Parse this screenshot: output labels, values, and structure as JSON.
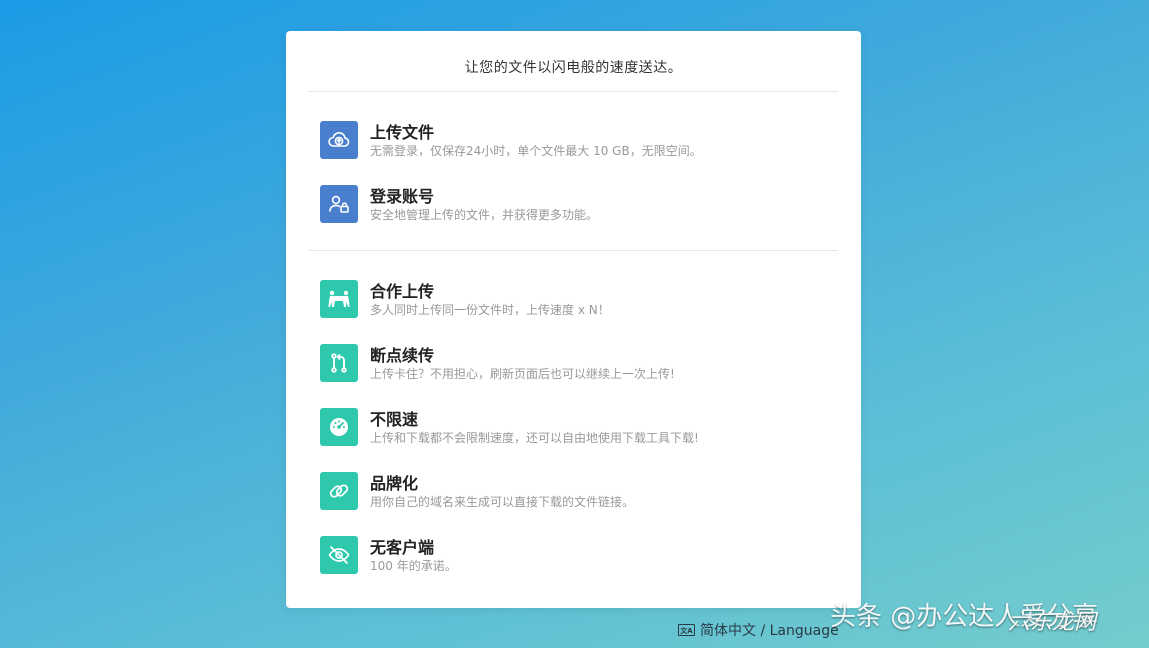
{
  "tagline": "让您的文件以闪电般的速度送达。",
  "features_primary": [
    {
      "icon": "cloud-upload-icon",
      "title": "上传文件",
      "desc": "无需登录，仅保存24小时，单个文件最大 10 GB，无限空间。"
    },
    {
      "icon": "user-lock-icon",
      "title": "登录账号",
      "desc": "安全地管理上传的文件，并获得更多功能。"
    }
  ],
  "features_secondary": [
    {
      "icon": "collaboration-icon",
      "title": "合作上传",
      "desc": "多人同时上传同一份文件时，上传速度 x N！"
    },
    {
      "icon": "resume-branch-icon",
      "title": "断点续传",
      "desc": "上传卡住？不用担心，刷新页面后也可以继续上一次上传!"
    },
    {
      "icon": "speedometer-icon",
      "title": "不限速",
      "desc": "上传和下载都不会限制速度，还可以自由地使用下载工具下载!"
    },
    {
      "icon": "link-icon",
      "title": "品牌化",
      "desc": "用你自己的域名来生成可以直接下载的文件链接。"
    },
    {
      "icon": "eye-off-icon",
      "title": "无客户端",
      "desc": "100 年的承诺。"
    }
  ],
  "language": {
    "icon": "language-icon",
    "label": "简体中文 / Language"
  },
  "watermark": {
    "text": "头条 @办公达人爱分享",
    "overlay": "六东龙网"
  },
  "colors": {
    "primary_icon": "#4a7fcd",
    "secondary_icon": "#2ec9ac"
  }
}
